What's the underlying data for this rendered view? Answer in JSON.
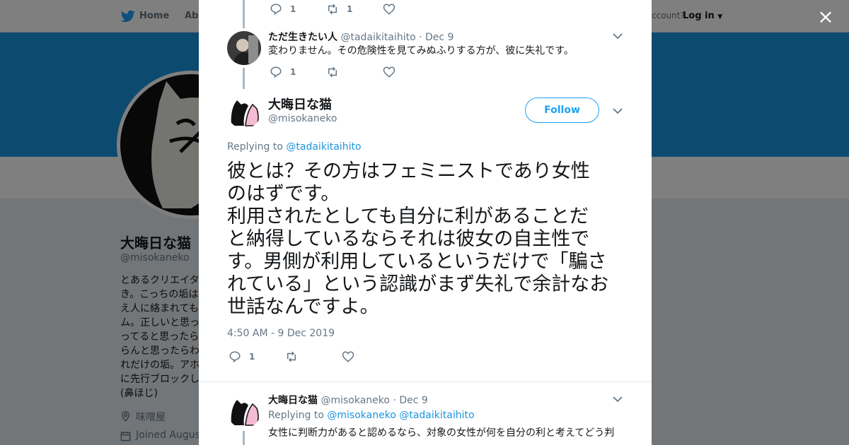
{
  "nav": {
    "home": "Home",
    "about": "Abo",
    "account": "ccount?",
    "login": "Log in"
  },
  "profile": {
    "name": "大晦日な猫",
    "handle": "@misokaneko",
    "bio": "とあるクリエイタ\nき。こっちの垢は\nえ人に絡まれても\nム。正しいと思っ\nってると思ったら\nらんと思ったらわ\nれだけの垢。アホ\nに先行ブロックし\n(鼻ほじ)",
    "location": "味噌屋",
    "joined": "Joined August"
  },
  "tweet1": {
    "reply_count": "1",
    "retweet_count": "1"
  },
  "tweet2": {
    "name": "ただ生きたい人",
    "handle": "@tadaikitaihito",
    "sep": "·",
    "date": "Dec 9",
    "text": "変わりません。その危険性を見てみぬふりする方が、彼に失礼です。",
    "reply_count": "1"
  },
  "main_tweet": {
    "name": "大晦日な猫",
    "handle": "@misokaneko",
    "follow_label": "Follow",
    "replying_prefix": "Replying to",
    "replying_to": "@tadaikitaihito",
    "text": "彼とは？その方はフェミニストであり女性\nのはずです。\n利用されたとしても自分に利があることだ\nと納得しているならそれは彼女の自主性で\nす。男側が利用しているというだけで「騙さ\nれている」という認識がまず失礼で余計なお\n世話なんですよ。",
    "timestamp": "4:50 AM - 9 Dec 2019",
    "reply_count": "1"
  },
  "tweet4": {
    "name": "大晦日な猫",
    "handle": "@misokaneko",
    "sep": "·",
    "date": "Dec 9",
    "replying_prefix": "Replying to",
    "replying_to_1": "@misokaneko",
    "replying_to_2": "@tadaikitaihito",
    "text": "女性に判断力があると認めるなら、対象の女性が何を自分の利と考えてどう判"
  },
  "close_label": "×",
  "colors": {
    "twitter_blue": "#1da1f2",
    "banner": "#1b95e0",
    "text": "#14171a",
    "muted": "#657786"
  }
}
